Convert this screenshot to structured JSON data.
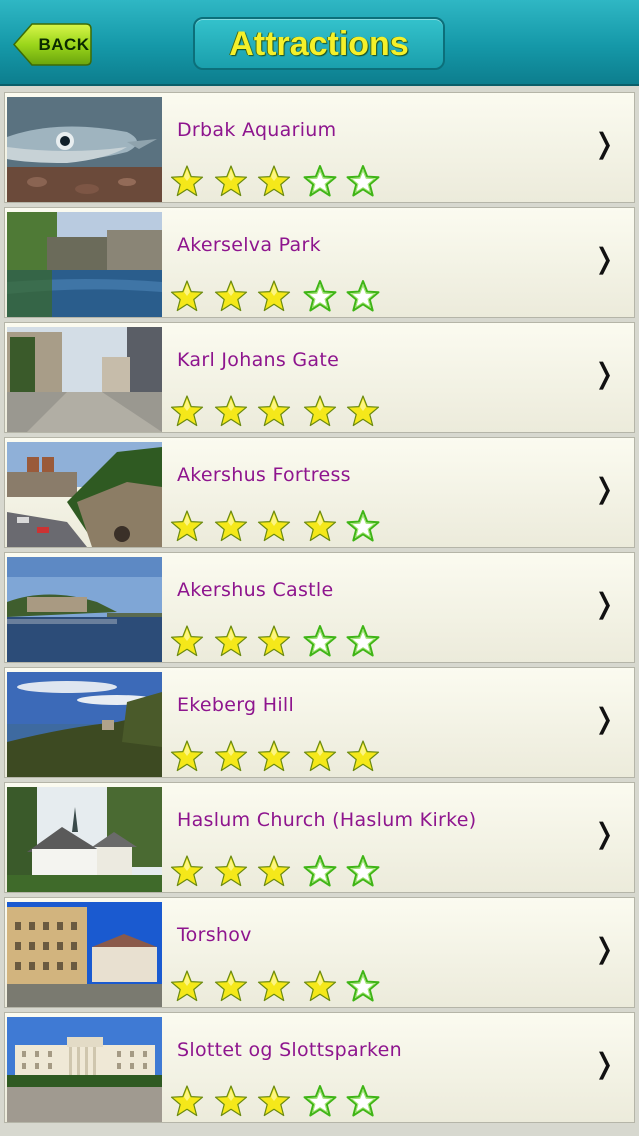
{
  "navbar": {
    "back_label": "BACK",
    "title": "Attractions"
  },
  "chevron": "❭",
  "items": [
    {
      "name": "Drbak Aquarium",
      "rating": 3,
      "image": "fish-photo"
    },
    {
      "name": "Akerselva Park",
      "rating": 3,
      "image": "river-photo"
    },
    {
      "name": "Karl Johans Gate",
      "rating": 5,
      "image": "street-photo"
    },
    {
      "name": "Akershus Fortress",
      "rating": 4,
      "image": "fortress-photo"
    },
    {
      "name": "Akershus Castle",
      "rating": 3,
      "image": "harbor-photo"
    },
    {
      "name": "Ekeberg Hill",
      "rating": 5,
      "image": "hill-photo"
    },
    {
      "name": "Haslum Church (Haslum Kirke)",
      "rating": 3,
      "image": "church-photo"
    },
    {
      "name": "Torshov",
      "rating": 4,
      "image": "buildings-photo"
    },
    {
      "name": "Slottet og Slottsparken",
      "rating": 3,
      "image": "palace-photo"
    }
  ],
  "colors": {
    "navbar": "#1598a8",
    "title": "#f4f02a",
    "item_name": "#8e158e",
    "star_fill": "#f5e81a",
    "star_outline": "#3fb516"
  }
}
